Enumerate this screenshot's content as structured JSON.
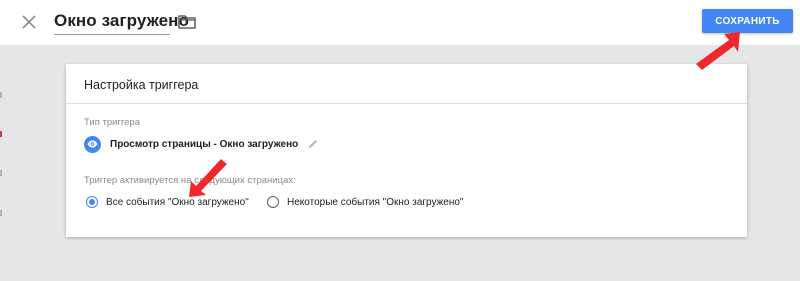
{
  "header": {
    "title": "Окно загружено",
    "save_label": "СОХРАНИТЬ",
    "icons": {
      "close": "close-icon",
      "folder": "folder-icon"
    }
  },
  "card": {
    "title": "Настройка триггера",
    "trigger_type_label": "Тип триггера",
    "trigger_type_value": "Просмотр страницы - Окно загружено",
    "trigger_type_icon": "eye-icon",
    "fires_on_label": "Триггер активируется на следующих страницах:",
    "options": [
      {
        "label": "Все события \"Окно загружено\"",
        "selected": true
      },
      {
        "label": "Некоторые события \"Окно загружено\"",
        "selected": false
      }
    ]
  },
  "colors": {
    "accent": "#4285f4",
    "annotation_arrow": "#f0282d",
    "background": "#e6e6e6"
  }
}
